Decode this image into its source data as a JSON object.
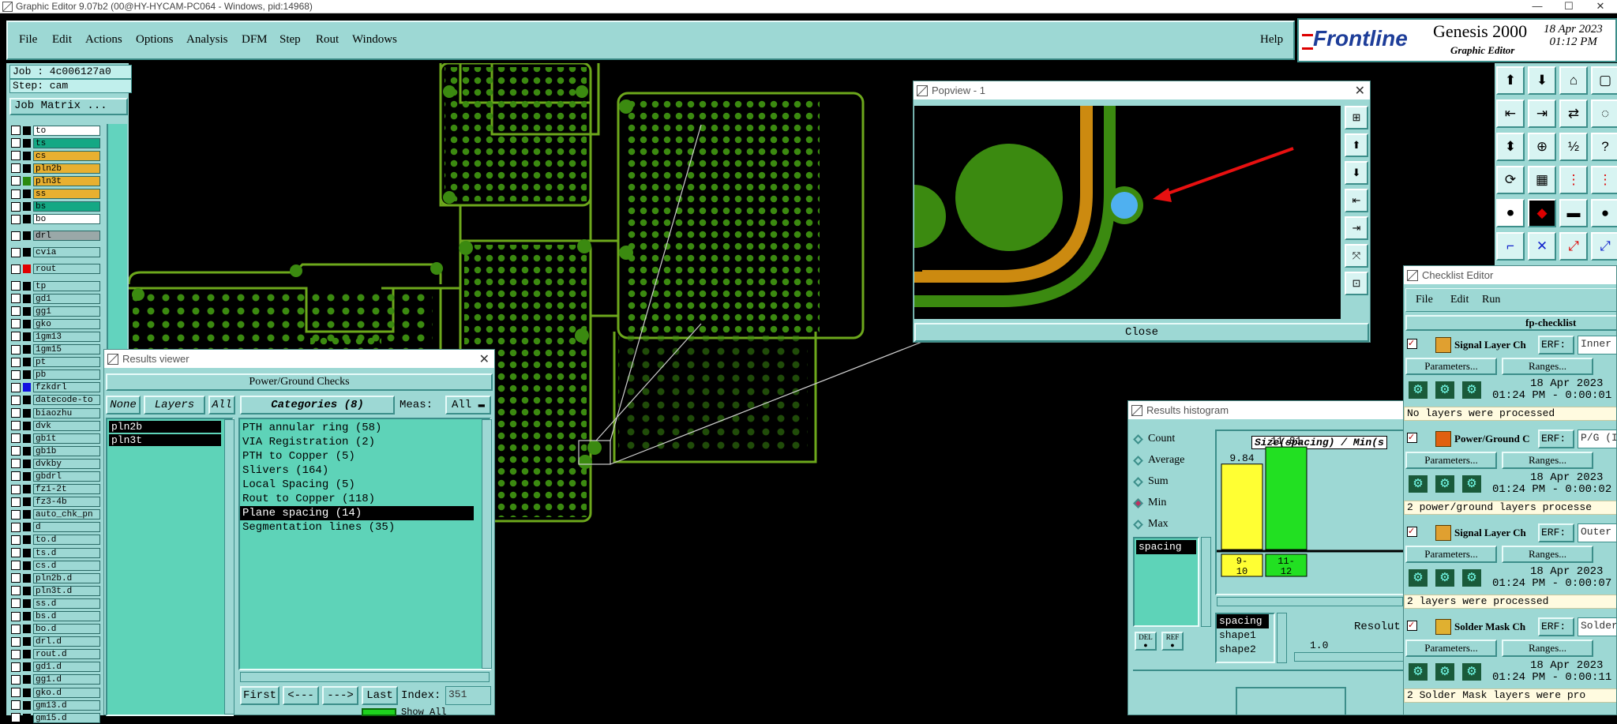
{
  "window": {
    "title": "Graphic Editor 9.07b2 (00@HY-HYCAM-PC064 - Windows, pid:14968)",
    "min": "—",
    "max": "☐",
    "close": "✕"
  },
  "menu": {
    "file": "File",
    "edit": "Edit",
    "actions": "Actions",
    "options": "Options",
    "analysis": "Analysis",
    "dfm": "DFM",
    "step": "Step",
    "rout": "Rout",
    "windows": "Windows",
    "help": "Help"
  },
  "brand": {
    "logo": "Frontline",
    "product": "Genesis 2000",
    "subtitle": "Graphic Editor",
    "date": "18 Apr 2023",
    "time": "01:12 PM"
  },
  "job": {
    "job_line": "Job : 4c006127a0",
    "step_line": "Step: cam",
    "matrix_button": "Job Matrix ..."
  },
  "layers": [
    {
      "name": "to",
      "swatch": "#000",
      "fill": "#ffffff"
    },
    {
      "name": "ts",
      "swatch": "#000",
      "fill": "#14a884"
    },
    {
      "name": "cs",
      "swatch": "#000",
      "fill": "#e8b030"
    },
    {
      "name": "pln2b",
      "swatch": "#000",
      "fill": "#e8b030"
    },
    {
      "name": "pln3t",
      "swatch": "#2a8a10",
      "fill": "#e8b030"
    },
    {
      "name": "ss",
      "swatch": "#000",
      "fill": "#e8b030"
    },
    {
      "name": "bs",
      "swatch": "#000",
      "fill": "#14a884"
    },
    {
      "name": "bo",
      "swatch": "#000",
      "fill": "#ffffff"
    },
    {
      "sep": true
    },
    {
      "name": "drl",
      "swatch": "#000",
      "fill": "#9aa8a8"
    },
    {
      "sep": true
    },
    {
      "name": "cvia",
      "swatch": "#000",
      "fill": "#9dd8d4"
    },
    {
      "sep": true
    },
    {
      "name": "rout",
      "swatch": "#e00000",
      "fill": "#9dd8d4"
    },
    {
      "sep": true
    },
    {
      "name": "tp",
      "swatch": "#000",
      "fill": "#9dd8d4"
    },
    {
      "name": "gd1",
      "swatch": "#000",
      "fill": "#9dd8d4"
    },
    {
      "name": "gg1",
      "swatch": "#000",
      "fill": "#9dd8d4"
    },
    {
      "name": "gko",
      "swatch": "#000",
      "fill": "#9dd8d4"
    },
    {
      "name": "1gm13",
      "swatch": "#000",
      "fill": "#9dd8d4"
    },
    {
      "name": "1gm15",
      "swatch": "#000",
      "fill": "#9dd8d4"
    },
    {
      "name": "pt",
      "swatch": "#000",
      "fill": "#9dd8d4"
    },
    {
      "name": "pb",
      "swatch": "#000",
      "fill": "#9dd8d4"
    },
    {
      "name": "fzkdrl",
      "swatch": "#1010e0",
      "fill": "#9dd8d4"
    },
    {
      "name": "datecode-to",
      "swatch": "#000",
      "fill": "#9dd8d4"
    },
    {
      "name": "biaozhu",
      "swatch": "#000",
      "fill": "#9dd8d4"
    },
    {
      "name": "dvk",
      "swatch": "#000",
      "fill": "#9dd8d4"
    },
    {
      "name": "gb1t",
      "swatch": "#000",
      "fill": "#9dd8d4"
    },
    {
      "name": "gb1b",
      "swatch": "#000",
      "fill": "#9dd8d4"
    },
    {
      "name": "dvkby",
      "swatch": "#000",
      "fill": "#9dd8d4"
    },
    {
      "name": "gbdrl",
      "swatch": "#000",
      "fill": "#9dd8d4"
    },
    {
      "name": "fz1-2t",
      "swatch": "#000",
      "fill": "#9dd8d4"
    },
    {
      "name": "fz3-4b",
      "swatch": "#000",
      "fill": "#9dd8d4"
    },
    {
      "name": "auto_chk_pn",
      "swatch": "#000",
      "fill": "#9dd8d4"
    },
    {
      "name": "d",
      "swatch": "#000",
      "fill": "#9dd8d4"
    },
    {
      "name": "to.d",
      "swatch": "#000",
      "fill": "#9dd8d4"
    },
    {
      "name": "ts.d",
      "swatch": "#000",
      "fill": "#9dd8d4"
    },
    {
      "name": "cs.d",
      "swatch": "#000",
      "fill": "#9dd8d4"
    },
    {
      "name": "pln2b.d",
      "swatch": "#000",
      "fill": "#9dd8d4"
    },
    {
      "name": "pln3t.d",
      "swatch": "#000",
      "fill": "#9dd8d4"
    },
    {
      "name": "ss.d",
      "swatch": "#000",
      "fill": "#9dd8d4"
    },
    {
      "name": "bs.d",
      "swatch": "#000",
      "fill": "#9dd8d4"
    },
    {
      "name": "bo.d",
      "swatch": "#000",
      "fill": "#9dd8d4"
    },
    {
      "name": "drl.d",
      "swatch": "#000",
      "fill": "#9dd8d4"
    },
    {
      "name": "rout.d",
      "swatch": "#000",
      "fill": "#9dd8d4"
    },
    {
      "name": "gd1.d",
      "swatch": "#000",
      "fill": "#9dd8d4"
    },
    {
      "name": "gg1.d",
      "swatch": "#000",
      "fill": "#9dd8d4"
    },
    {
      "name": "gko.d",
      "swatch": "#000",
      "fill": "#9dd8d4"
    },
    {
      "name": "gm13.d",
      "swatch": "#000",
      "fill": "#9dd8d4"
    },
    {
      "name": "gm15.d",
      "swatch": "#000",
      "fill": "#9dd8d4"
    }
  ],
  "popview": {
    "title": "Popview - 1",
    "close_button": "Close"
  },
  "results_viewer": {
    "title": "Results viewer",
    "header": "Power/Ground Checks",
    "none": "None",
    "layers": "Layers",
    "all": "All",
    "categories": "Categories (8)",
    "meas_label": "Meas:",
    "meas_value": "All",
    "layer_items": [
      "pln2b",
      "pln3t"
    ],
    "category_items": [
      "PTH annular ring (58)",
      "VIA Registration (2)",
      "PTH to Copper (5)",
      "Slivers (164)",
      "Local Spacing (5)",
      "Rout to Copper (118)",
      "Plane spacing (14)",
      "Segmentation lines (35)"
    ],
    "selected_category": "Plane spacing (14)",
    "first": "First",
    "prev": "<---",
    "next": "--->",
    "last": "Last",
    "index_label": "Index:",
    "index_value": "351",
    "show_all": "Show All"
  },
  "histogram": {
    "title": "Results histogram",
    "radios": [
      "Count",
      "Average",
      "Sum",
      "Min",
      "Max"
    ],
    "selected": "Min",
    "filter": "spacing",
    "chart_title": "Size(spacing) / Min(s",
    "del": "DEL",
    "ref": "REF",
    "list": [
      "spacing",
      "shape1",
      "shape2"
    ],
    "resolution_label": "Resolut",
    "resolution_value": "1.0"
  },
  "chart_data": {
    "type": "bar",
    "categories": [
      "9-10",
      "11-12"
    ],
    "values": [
      9.84,
      11.81
    ],
    "title": "Size(spacing) / Min(s",
    "colors": [
      "#ffff33",
      "#22e022"
    ]
  },
  "checklist": {
    "title": "Checklist Editor",
    "file": "File",
    "edit": "Edit",
    "run": "Run",
    "name": "fp-checklist",
    "params": "Parameters...",
    "ranges": "Ranges...",
    "items": [
      {
        "name": "Signal Layer Ch",
        "erf": "ERF:",
        "field": "Inner",
        "date": "18 Apr 2023",
        "time": "01:24 PM - 0:00:01",
        "status": "No layers were processed"
      },
      {
        "name": "Power/Ground C",
        "erf": "ERF:",
        "field": "P/G (I",
        "date": "18 Apr 2023",
        "time": "01:24 PM - 0:00:02",
        "status": "2 power/ground layers processe"
      },
      {
        "name": "Signal Layer Ch",
        "erf": "ERF:",
        "field": "Outer",
        "date": "18 Apr 2023",
        "time": "01:24 PM - 0:00:07",
        "status": "2 layers were processed"
      },
      {
        "name": "Solder Mask Ch",
        "erf": "ERF:",
        "field": "Solder",
        "date": "18 Apr 2023",
        "time": "01:24 PM - 0:00:11",
        "status": "2 Solder Mask layers were pro"
      }
    ]
  },
  "colors": {
    "panel": "#9dd8d4",
    "pcb_copper": "#3b8a10",
    "pcb_outline": "#6da81c",
    "highlight_pad": "#4fb0f0",
    "arrow": "#e81010"
  }
}
